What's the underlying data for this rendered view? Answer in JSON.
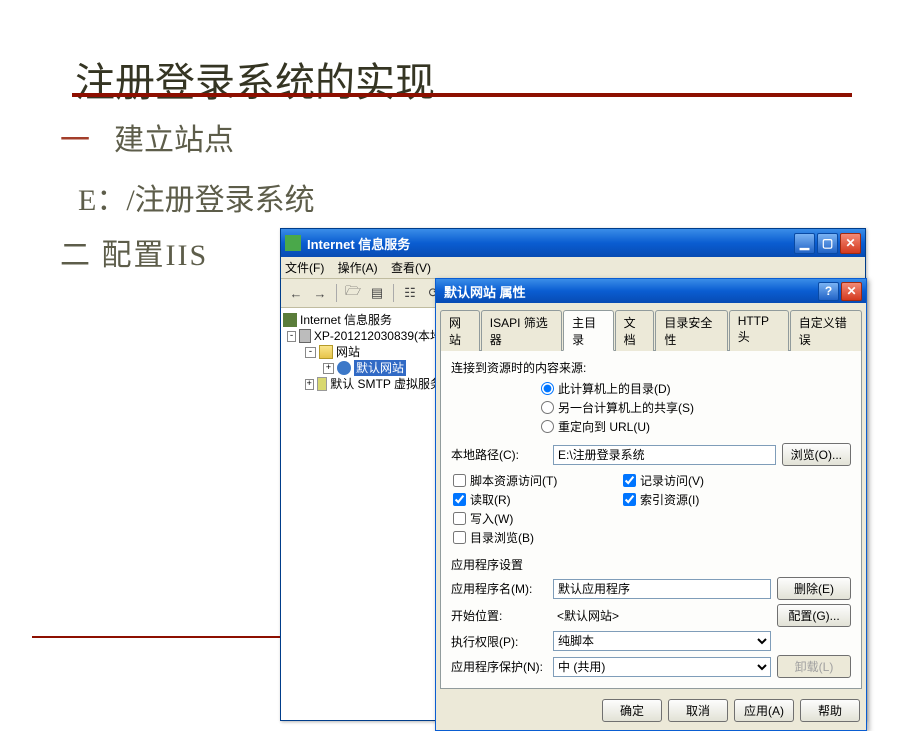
{
  "slide": {
    "title": "注册登录系统的实现",
    "line1": "建立站点",
    "line2": "E：/注册登录系统",
    "line3": "二 配置IIS"
  },
  "iis": {
    "title": "Internet 信息服务",
    "menu": {
      "file": "文件(F)",
      "action": "操作(A)",
      "view": "查看(V)"
    },
    "tree": {
      "root": "Internet 信息服务",
      "computer": "XP-201212030839(本地",
      "websites": "网站",
      "default_site": "默认网站",
      "smtp": "默认 SMTP 虚拟服务"
    }
  },
  "dlg": {
    "title": "默认网站 属性",
    "tabs": {
      "site": "网站",
      "isapi": "ISAPI 筛选器",
      "home": "主目录",
      "docs": "文档",
      "dirsec": "目录安全性",
      "http": "HTTP 头",
      "custerr": "自定义错误"
    },
    "source_label": "连接到资源时的内容来源:",
    "radio": {
      "local": "此计算机上的目录(D)",
      "share": "另一台计算机上的共享(S)",
      "redirect": "重定向到 URL(U)"
    },
    "path_label": "本地路径(C):",
    "path_value": "E:\\注册登录系统",
    "browse_btn": "浏览(O)...",
    "checks": {
      "script": "脚本资源访问(T)",
      "read": "读取(R)",
      "write": "写入(W)",
      "browse": "目录浏览(B)",
      "logvisit": "记录访问(V)",
      "index": "索引资源(I)"
    },
    "app_section": "应用程序设置",
    "app_name_label": "应用程序名(M):",
    "app_name_value": "默认应用程序",
    "remove_btn": "删除(E)",
    "start_label": "开始位置:",
    "start_value": "<默认网站>",
    "config_btn": "配置(G)...",
    "exec_label": "执行权限(P):",
    "exec_value": "纯脚本",
    "protect_label": "应用程序保护(N):",
    "protect_value": "中 (共用)",
    "unload_btn": "卸载(L)",
    "footer": {
      "ok": "确定",
      "cancel": "取消",
      "apply": "应用(A)",
      "help": "帮助"
    }
  }
}
